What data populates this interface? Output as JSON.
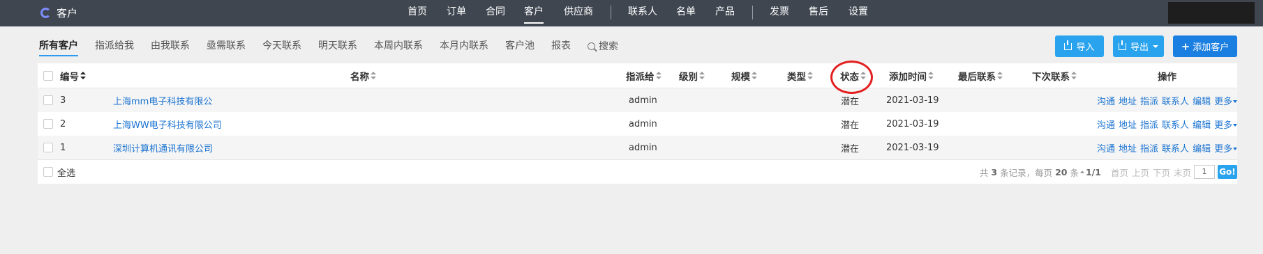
{
  "app": {
    "title": "客户"
  },
  "nav": {
    "items": [
      "首页",
      "订单",
      "合同",
      "客户",
      "供应商",
      "联系人",
      "名单",
      "产品",
      "发票",
      "售后",
      "设置"
    ],
    "active": "客户"
  },
  "tabs": [
    "所有客户",
    "指派给我",
    "由我联系",
    "亟需联系",
    "今天联系",
    "明天联系",
    "本周内联系",
    "本月内联系",
    "客户池",
    "报表",
    "搜索"
  ],
  "actions": {
    "import": "导入",
    "export": "导出",
    "add": "添加客户"
  },
  "table": {
    "headers": {
      "id": "编号",
      "name": "名称",
      "assign": "指派给",
      "level": "级别",
      "scale": "规模",
      "type": "类型",
      "status": "状态",
      "added": "添加时间",
      "last": "最后联系",
      "next": "下次联系",
      "ops": "操作"
    },
    "rows": [
      {
        "id": "3",
        "name": "上海mm电子科技有限公",
        "assign": "admin",
        "status": "潜在",
        "added": "2021-03-19"
      },
      {
        "id": "2",
        "name": "上海WW电子科技有限公司",
        "assign": "admin",
        "status": "潜在",
        "added": "2021-03-19"
      },
      {
        "id": "1",
        "name": "深圳计算机通讯有限公司",
        "assign": "admin",
        "status": "潜在",
        "added": "2021-03-19"
      }
    ],
    "row_ops": [
      "沟通",
      "地址",
      "指派",
      "联系人",
      "编辑",
      "更多"
    ],
    "footer": {
      "select_all": "全选",
      "total_prefix": "共",
      "total": "3",
      "total_suffix": "条记录，每页",
      "per_page": "20",
      "per_page_suffix": "条",
      "page_info": "1/1",
      "first": "首页",
      "prev": "上页",
      "next": "下页",
      "last": "末页",
      "page_input": "1",
      "go": "Go!"
    }
  },
  "colors": {
    "topbar": "#3f4650",
    "accent": "#2aa3ef",
    "add_button": "#1a7fe0",
    "link": "#1a73d1",
    "annotation": "#e32020"
  }
}
